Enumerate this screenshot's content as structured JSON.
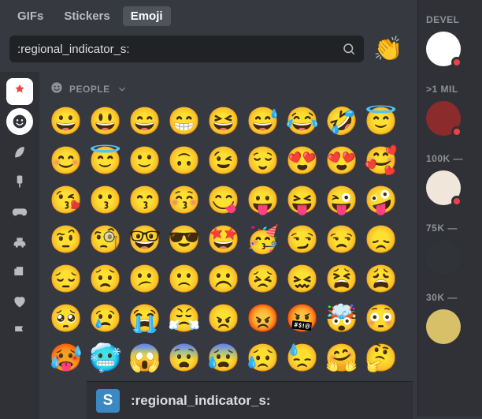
{
  "tabs": [
    {
      "label": "GIFs",
      "active": false
    },
    {
      "label": "Stickers",
      "active": false
    },
    {
      "label": "Emoji",
      "active": true
    }
  ],
  "search": {
    "value": ":regional_indicator_s:",
    "placeholder": ":regional_indicator_s:"
  },
  "preview_emoji": "👏",
  "side_nav": [
    {
      "icon": "server-red",
      "name": "server-1"
    },
    {
      "icon": "smile",
      "name": "people-category"
    },
    {
      "icon": "leaf",
      "name": "nature-category"
    },
    {
      "icon": "popsicle",
      "name": "food-category"
    },
    {
      "icon": "gamepad",
      "name": "activities-category"
    },
    {
      "icon": "car",
      "name": "travel-category"
    },
    {
      "icon": "mug",
      "name": "objects-category"
    },
    {
      "icon": "heart",
      "name": "symbols-category"
    },
    {
      "icon": "flag",
      "name": "flags-category"
    }
  ],
  "category_label": "PEOPLE",
  "emoji_grid": [
    [
      "😀",
      "😃",
      "😄",
      "😁",
      "😆",
      "😅",
      "😂",
      "🤣",
      "😇"
    ],
    [
      "😊",
      "😇",
      "🙂",
      "🙃",
      "😉",
      "😌",
      "😍",
      "😍",
      "🥰"
    ],
    [
      "😘",
      "😗",
      "😙",
      "😚",
      "😋",
      "😛",
      "😝",
      "😜",
      "🤪"
    ],
    [
      "🤨",
      "🧐",
      "🤓",
      "😎",
      "🤩",
      "🥳",
      "😏",
      "😒",
      "😞"
    ],
    [
      "😔",
      "😟",
      "😕",
      "🙁",
      "☹️",
      "😣",
      "😖",
      "😫",
      "😩"
    ],
    [
      "🥺",
      "😢",
      "😭",
      "😤",
      "😠",
      "😡",
      "🤬",
      "🤯",
      "😳"
    ],
    [
      "🥵",
      "🥶",
      "😱",
      "😨",
      "😰",
      "😥",
      "😓",
      "🤗",
      "🤔"
    ]
  ],
  "footer": {
    "letter": "S",
    "label": ":regional_indicator_s:"
  },
  "right_rail": {
    "sections": [
      {
        "title": "DEVEL",
        "avatar_bg": "#ffffff",
        "status": "red"
      },
      {
        "title": ">1 MIL",
        "avatar_bg": "#8b2b2b",
        "status": "red"
      },
      {
        "title": "100K —",
        "avatar_bg": "#f0e6da",
        "status": "red"
      },
      {
        "title": "75K —",
        "avatar_bg": "#303338",
        "status": "none"
      },
      {
        "title": "30K —",
        "avatar_bg": "#d8c069",
        "status": "none"
      }
    ]
  }
}
